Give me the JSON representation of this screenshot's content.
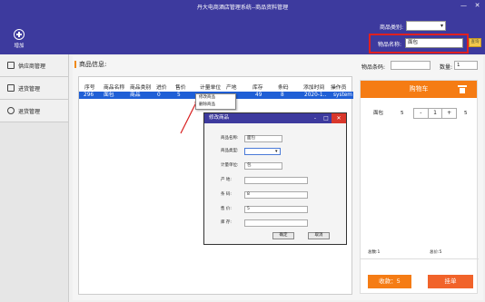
{
  "window": {
    "title": "丹大电商酒店管理系统--商品资料管理",
    "minimize": "—",
    "close": "✕"
  },
  "toolbar": {
    "add_label": "增加"
  },
  "filters": {
    "category_label": "商品类别:",
    "category_value": "",
    "name_label": "物品名称:",
    "name_value": "面包",
    "search_btn": "查询"
  },
  "sidebar": {
    "items": [
      {
        "label": "供应商管理"
      },
      {
        "label": "进货管理"
      },
      {
        "label": "退货管理"
      }
    ]
  },
  "main": {
    "info_title": "商品信息:",
    "code_label": "物品条码:",
    "code_value": "",
    "qty_label": "数量:",
    "qty_value": "1"
  },
  "table": {
    "headers": [
      "序号",
      "商品名称",
      "商品类别",
      "进价",
      "售价",
      "计量单位",
      "产地",
      "库存",
      "条码",
      "添加时间",
      "操作员"
    ],
    "rows": [
      [
        "296",
        "面包",
        "商品",
        "0",
        "5",
        "",
        "",
        "49",
        "8",
        "2020-1..",
        "system"
      ]
    ]
  },
  "context_menu": {
    "items": [
      "修改商品",
      "删除商品"
    ]
  },
  "dialog": {
    "title": "修改商品",
    "min": "-",
    "restore": "□",
    "close": "✕",
    "fields": [
      {
        "label": "商品名称:",
        "value": "面包"
      },
      {
        "label": "商品类型:",
        "value": "",
        "select": "true"
      },
      {
        "label": "计量单位:",
        "value": "包"
      },
      {
        "label": "产  地:",
        "value": ""
      },
      {
        "label": "条  码:",
        "value": "8"
      },
      {
        "label": "售  价:",
        "value": "5"
      },
      {
        "label": "库  存:",
        "value": ""
      }
    ],
    "ok_label": "确定",
    "cancel_label": "取消"
  },
  "cart": {
    "title": "购物车",
    "item_name": "面包",
    "item_price": "5",
    "minus": "-",
    "qty": "1",
    "plus": "+",
    "item_total": "5",
    "total_count": "总数:1",
    "total_price": "总价:5",
    "checkout_label": "收款：5",
    "hang_label": "挂单"
  },
  "colors": {
    "header": "#3d3a9e",
    "accent": "#f57c14",
    "selected_row": "#1f5fd6",
    "highlight": "#e02020",
    "close": "#d9372b"
  }
}
